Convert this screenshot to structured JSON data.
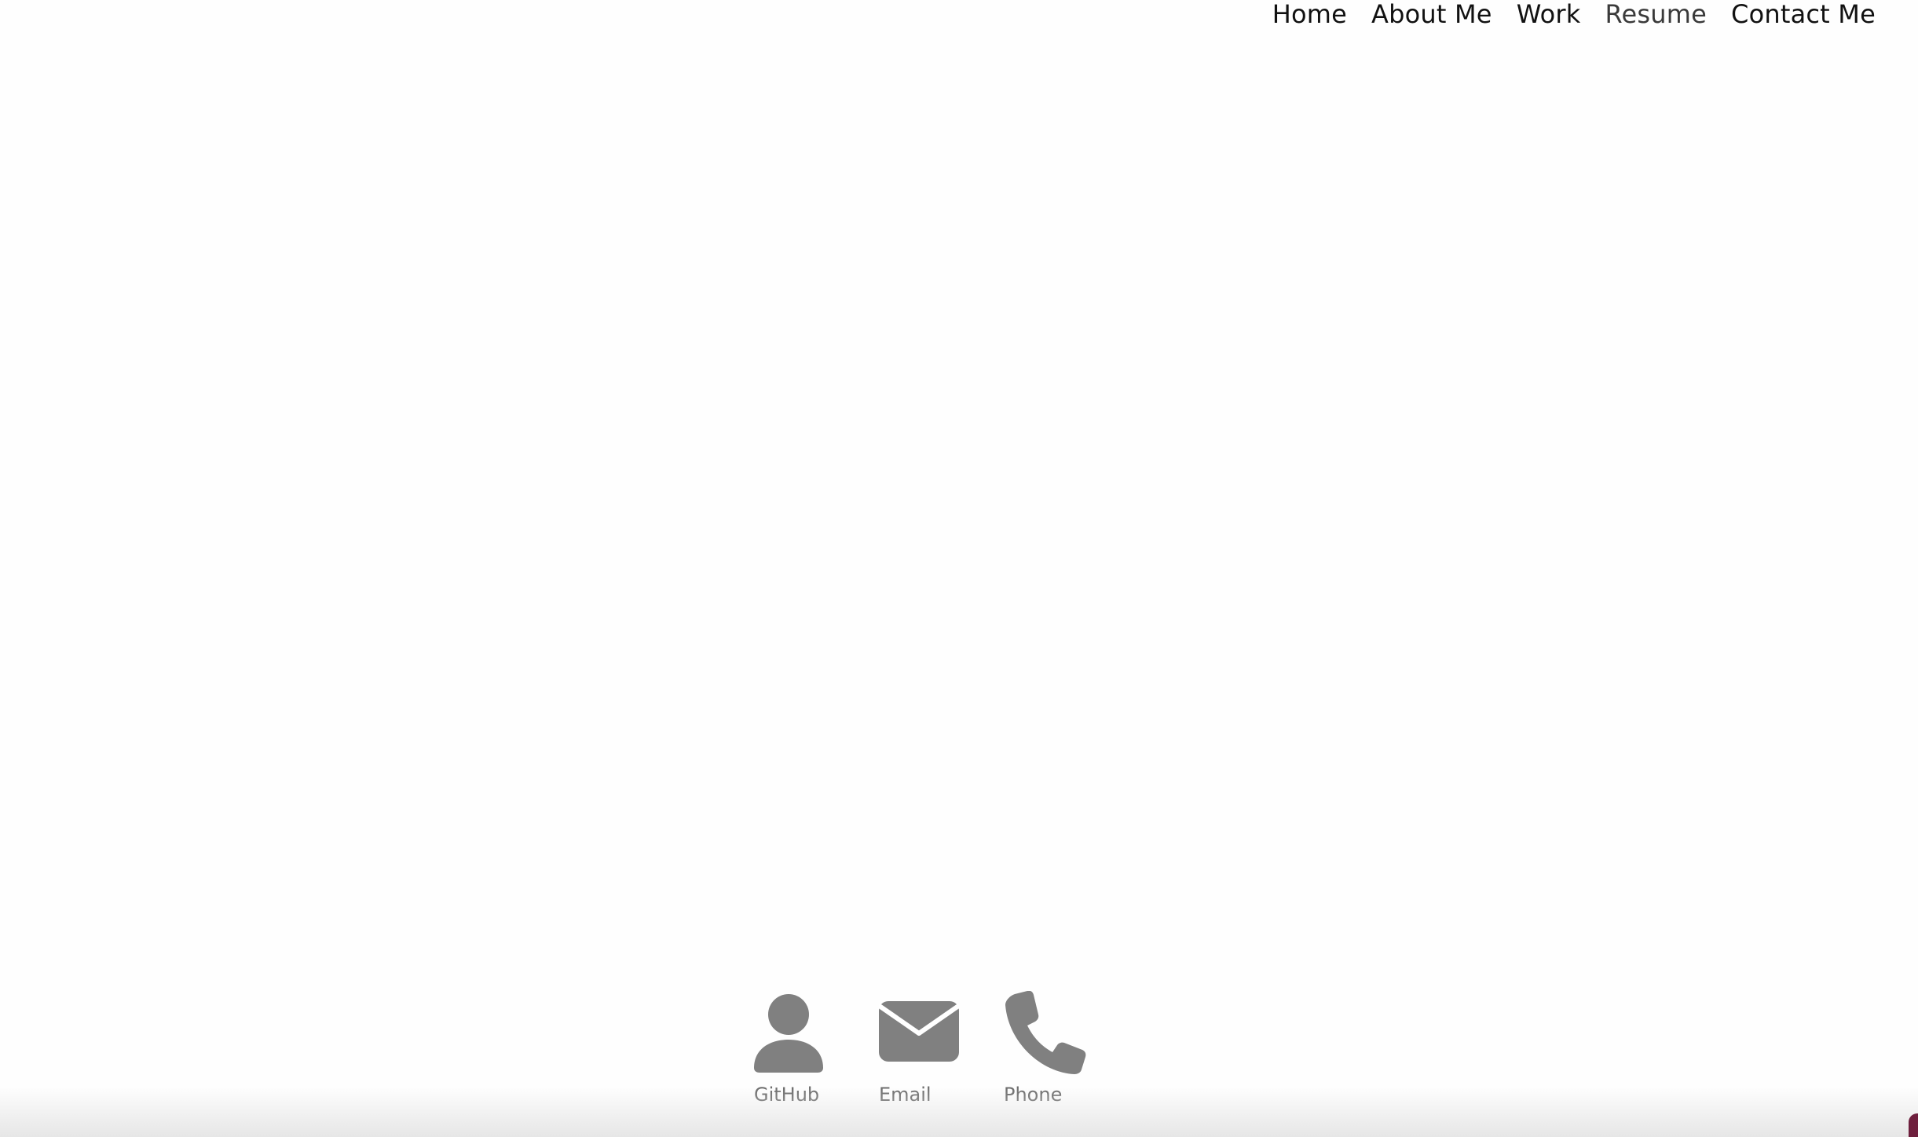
{
  "nav": {
    "items": [
      {
        "label": "Home"
      },
      {
        "label": "About Me"
      },
      {
        "label": "Work"
      },
      {
        "label": "Resume"
      },
      {
        "label": "Contact Me"
      }
    ]
  },
  "contacts": {
    "items": [
      {
        "label": "GitHub",
        "icon": "person-icon"
      },
      {
        "label": "Email",
        "icon": "envelope-icon"
      },
      {
        "label": "Phone",
        "icon": "phone-icon"
      }
    ]
  },
  "colors": {
    "icon": "#808080",
    "label": "#6b6b6b",
    "nav_text": "#111111",
    "accent": "#6e1f3d"
  }
}
